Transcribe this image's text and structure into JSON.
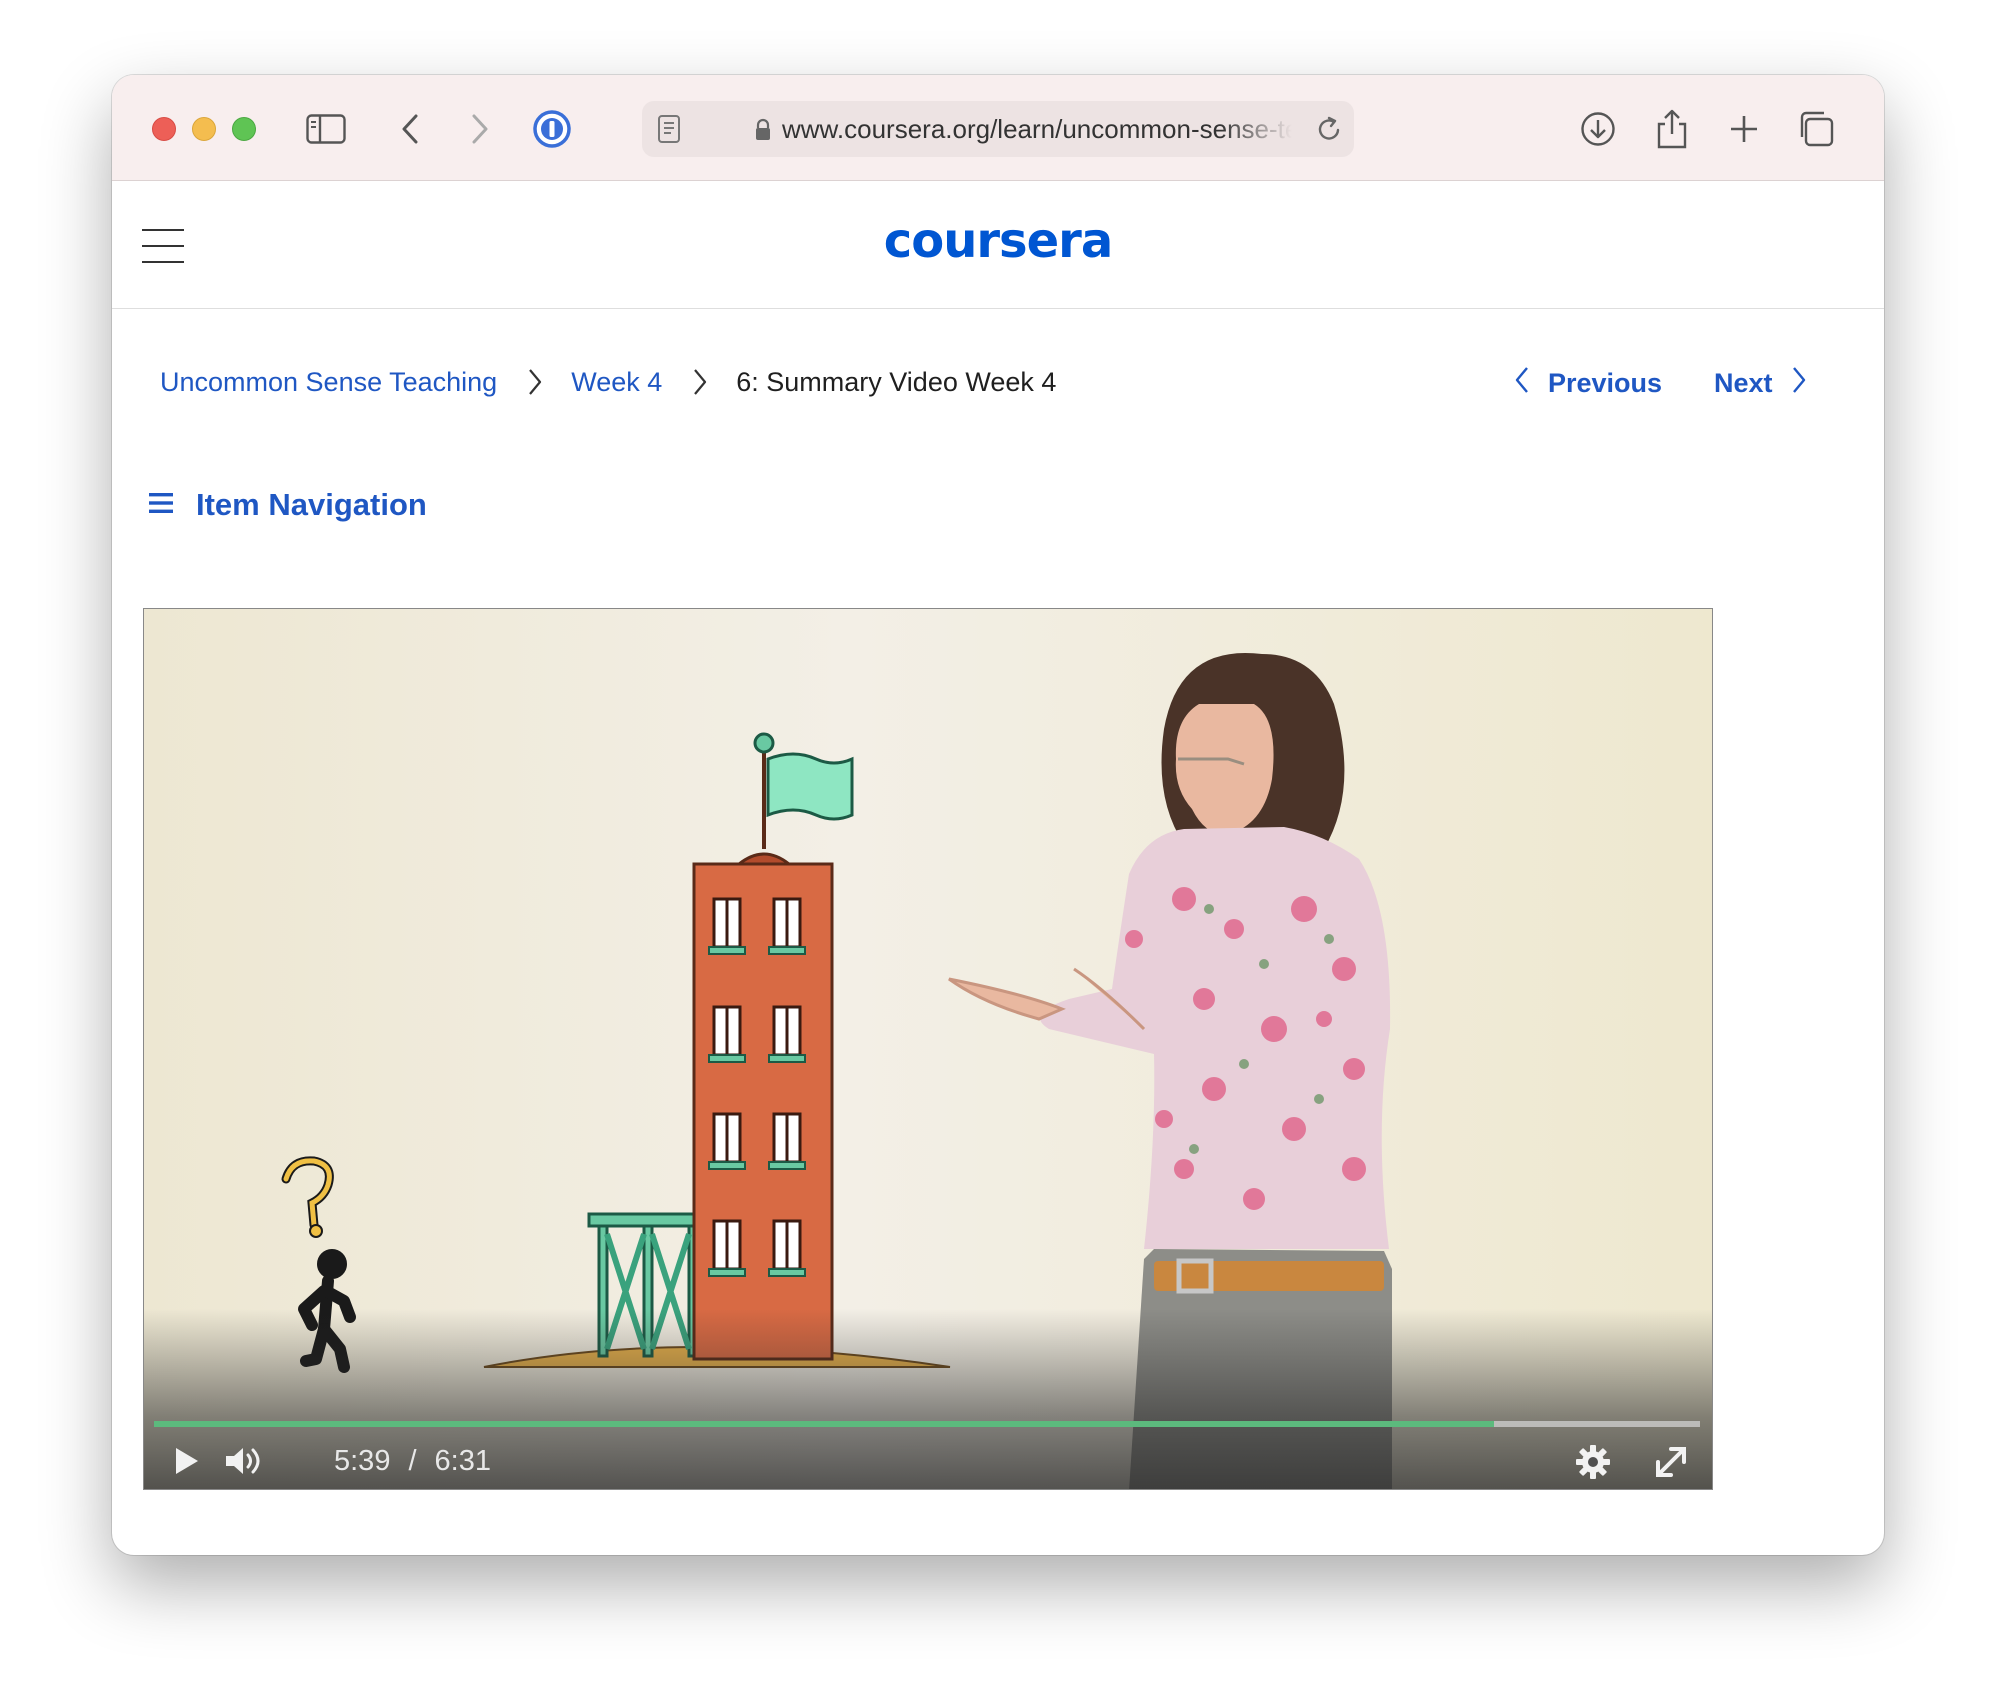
{
  "browser": {
    "url": "www.coursera.org/learn/uncommon-sense-teaching"
  },
  "site": {
    "logo": "coursera"
  },
  "breadcrumb": {
    "course": "Uncommon Sense Teaching",
    "week": "Week 4",
    "current": "6: Summary Video Week 4"
  },
  "pager": {
    "previous": "Previous",
    "next": "Next"
  },
  "item_navigation": {
    "label": "Item Navigation"
  },
  "video": {
    "current_time": "5:39",
    "separator": "/",
    "duration": "6:31",
    "progress_fraction": 0.867,
    "progress_color": "#5cba7d"
  },
  "colors": {
    "link": "#1f57c3",
    "brand": "#0056d2"
  },
  "icons": [
    "sidebar-icon",
    "back-icon",
    "forward-icon",
    "password-manager-icon",
    "reader-icon",
    "lock-icon",
    "reload-icon",
    "download-icon",
    "share-icon",
    "new-tab-icon",
    "tabs-overview-icon",
    "menu-icon",
    "chevron-right-icon",
    "chevron-left-icon",
    "list-icon",
    "play-icon",
    "volume-icon",
    "settings-icon",
    "fullscreen-icon"
  ]
}
